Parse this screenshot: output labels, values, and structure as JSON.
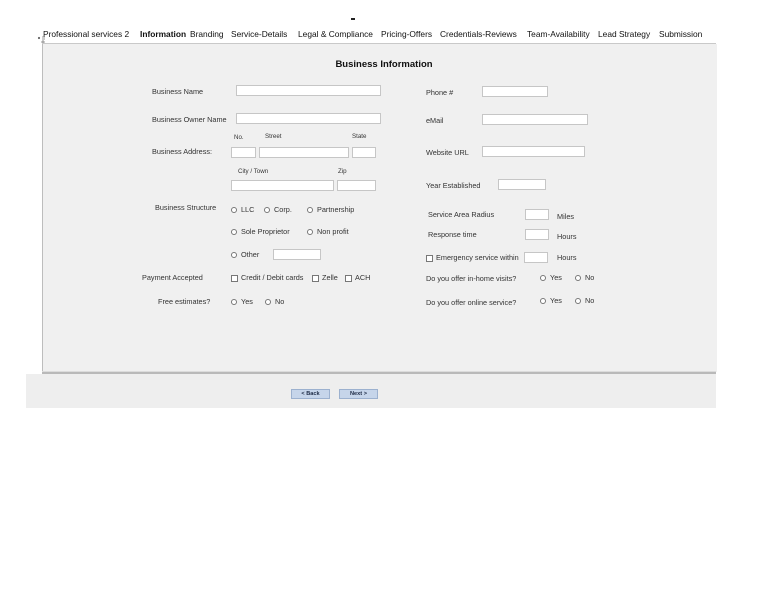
{
  "tabs": [
    {
      "label": "Professional services 2",
      "active": false
    },
    {
      "label": "Information",
      "active": true
    },
    {
      "label": "Branding",
      "active": false
    },
    {
      "label": "Service-Details",
      "active": false
    },
    {
      "label": "Legal & Compliance",
      "active": false
    },
    {
      "label": "Pricing-Offers",
      "active": false
    },
    {
      "label": "Credentials-Reviews",
      "active": false
    },
    {
      "label": "Team-Availability",
      "active": false
    },
    {
      "label": "Lead Strategy",
      "active": false
    },
    {
      "label": "Submission",
      "active": false
    }
  ],
  "form": {
    "title": "Business Information",
    "left": {
      "business_name_label": "Business Name",
      "business_owner_label": "Business Owner Name",
      "business_address_label": "Business Address:",
      "no_label": "No.",
      "street_label": "Street",
      "state_label": "State",
      "city_label": "City / Town",
      "zip_label": "Zip",
      "structure_label": "Business Structure",
      "structure_options": [
        "LLC",
        "Corp.",
        "Partnership",
        "Sole Proprietor",
        "Non profit",
        "Other"
      ],
      "payment_label": "Payment Accepted",
      "payment_options": [
        "Credit / Debit cards",
        "Zelle",
        "ACH"
      ],
      "free_estimates_label": "Free estimates?",
      "yes": "Yes",
      "no": "No"
    },
    "right": {
      "phone_label": "Phone #",
      "email_label": "eMail",
      "website_label": "Website URL",
      "year_label": "Year Established",
      "radius_label": "Service Area Radius",
      "radius_unit": "Miles",
      "response_label": "Response time",
      "response_unit": "Hours",
      "emergency_label": "Emergency service within",
      "emergency_unit": "Hours",
      "in_home_label": "Do you offer in-home visits?",
      "online_label": "Do you offer online service?",
      "yes": "Yes",
      "no": "No"
    }
  },
  "buttons": {
    "back": "< Back",
    "next": "Next >"
  }
}
